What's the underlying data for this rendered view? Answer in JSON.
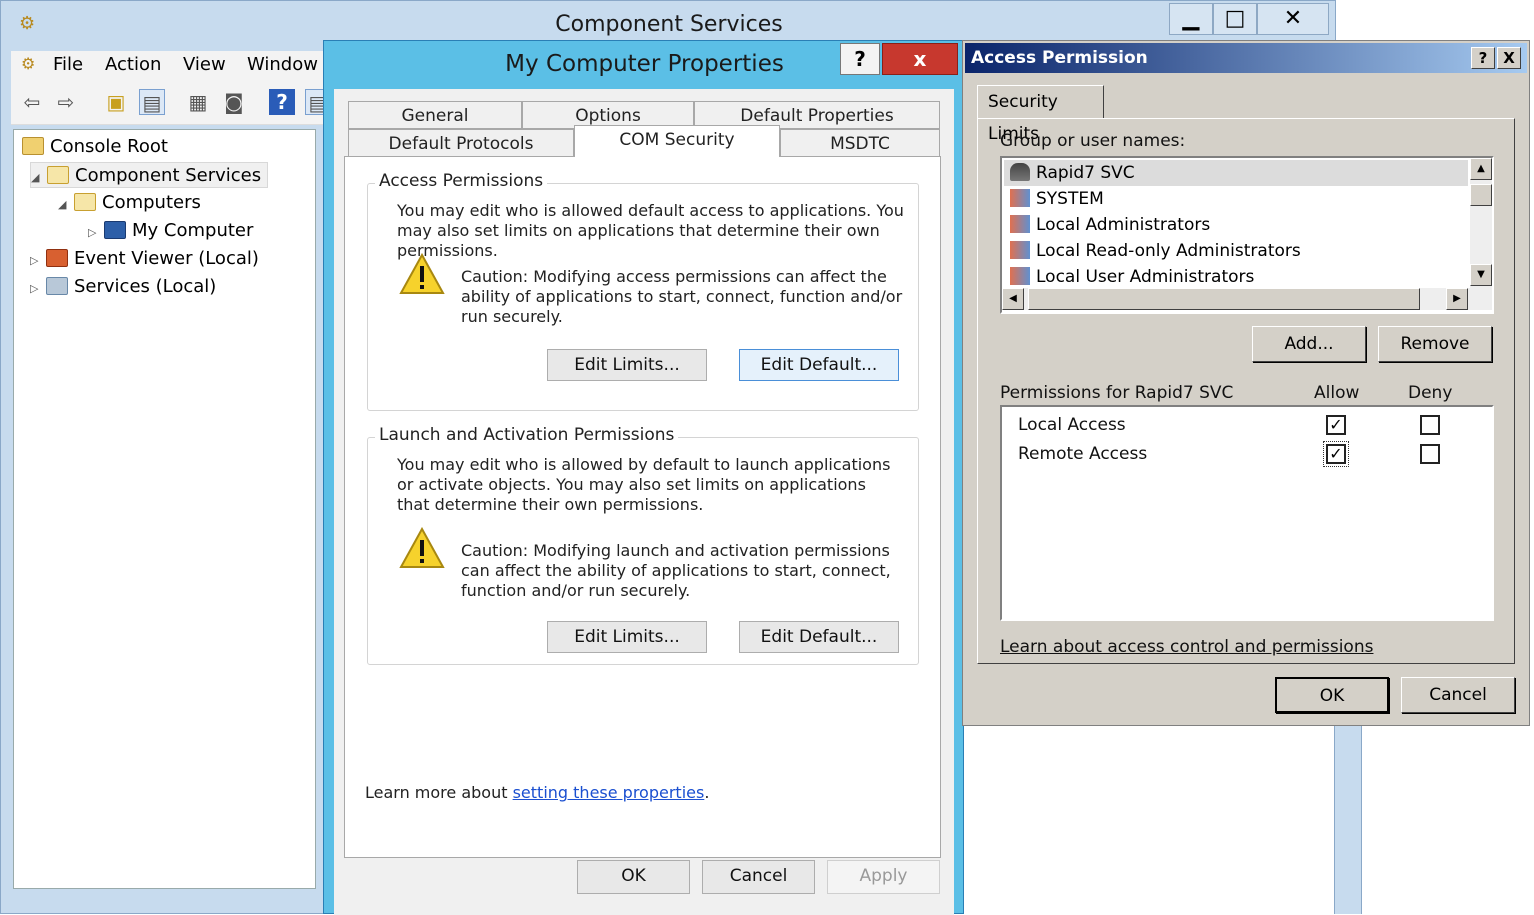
{
  "component_services": {
    "title": "Component Services",
    "menu": [
      "File",
      "Action",
      "View",
      "Window"
    ],
    "tree": {
      "console_root": "Console Root",
      "component_services": "Component Services",
      "computers": "Computers",
      "my_computer": "My Computer",
      "event_viewer": "Event Viewer (Local)",
      "services": "Services (Local)"
    }
  },
  "properties_dialog": {
    "title": "My Computer Properties",
    "help_glyph": "?",
    "close_glyph": "x",
    "tabs_row1": [
      "General",
      "Options",
      "Default Properties"
    ],
    "tabs_row2": [
      "Default Protocols",
      "COM Security",
      "MSDTC"
    ],
    "active_tab": "COM Security",
    "access": {
      "label": "Access Permissions",
      "text": "You may edit who is allowed default access to applications. You may also set limits on applications that determine their own permissions.",
      "caution": "Caution: Modifying access permissions can affect the ability of applications to start, connect, function and/or run securely.",
      "edit_limits": "Edit Limits...",
      "edit_default": "Edit Default..."
    },
    "launch": {
      "label": "Launch and Activation Permissions",
      "text": "You may edit who is allowed by default to launch applications or activate objects. You may also set limits on applications that determine their own permissions.",
      "caution": "Caution: Modifying launch and activation permissions can affect the ability of applications to start, connect, function and/or run securely.",
      "edit_limits": "Edit Limits...",
      "edit_default": "Edit Default..."
    },
    "learn_prefix": "Learn more about",
    "learn_link": "setting these properties",
    "learn_suffix": ".",
    "ok": "OK",
    "cancel": "Cancel",
    "apply": "Apply"
  },
  "access_permission": {
    "title": "Access Permission",
    "help_glyph": "?",
    "close_glyph": "X",
    "tab": "Security Limits",
    "group_label": "Group or user names:",
    "users": [
      "Rapid7 SVC",
      "SYSTEM",
      "Local Administrators",
      "Local Read-only Administrators",
      "Local User Administrators"
    ],
    "selected_user": "Rapid7 SVC",
    "add": "Add...",
    "remove": "Remove",
    "perms_label": "Permissions for Rapid7 SVC",
    "allow": "Allow",
    "deny": "Deny",
    "permissions": [
      {
        "name": "Local Access",
        "allow": true,
        "deny": false
      },
      {
        "name": "Remote Access",
        "allow": true,
        "deny": false
      }
    ],
    "learn_link": "Learn about access control and permissions",
    "ok": "OK",
    "cancel": "Cancel"
  }
}
